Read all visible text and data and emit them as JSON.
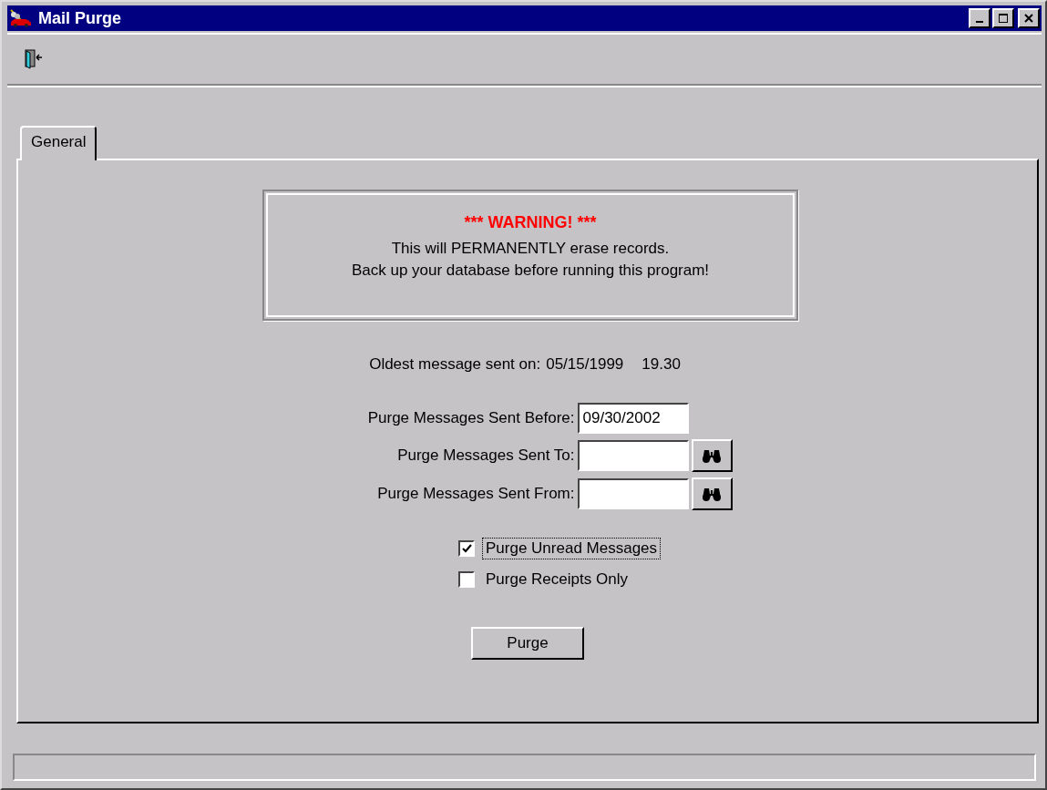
{
  "window": {
    "title": "Mail Purge"
  },
  "tabs": [
    {
      "label": "General",
      "selected": true
    }
  ],
  "warning": {
    "heading": "*** WARNING! ***",
    "lines": [
      "This will PERMANENTLY erase records.",
      "Back up your database before running this program!"
    ]
  },
  "oldest": {
    "label": "Oldest message sent on:",
    "date": "05/15/1999",
    "time": "19.30"
  },
  "fields": [
    {
      "label": "Purge Messages Sent Before:",
      "value": "09/30/2002",
      "kind": "date"
    },
    {
      "label": "Purge Messages Sent To:",
      "kind": "lookup"
    },
    {
      "label": "Purge Messages Sent From:",
      "kind": "lookup"
    }
  ],
  "options": [
    {
      "label": "Purge Unread Messages",
      "checked": true,
      "focused": true
    },
    {
      "label": "Purge Receipts Only",
      "checked": false,
      "focused": false
    }
  ],
  "buttons": [
    "Purge"
  ]
}
